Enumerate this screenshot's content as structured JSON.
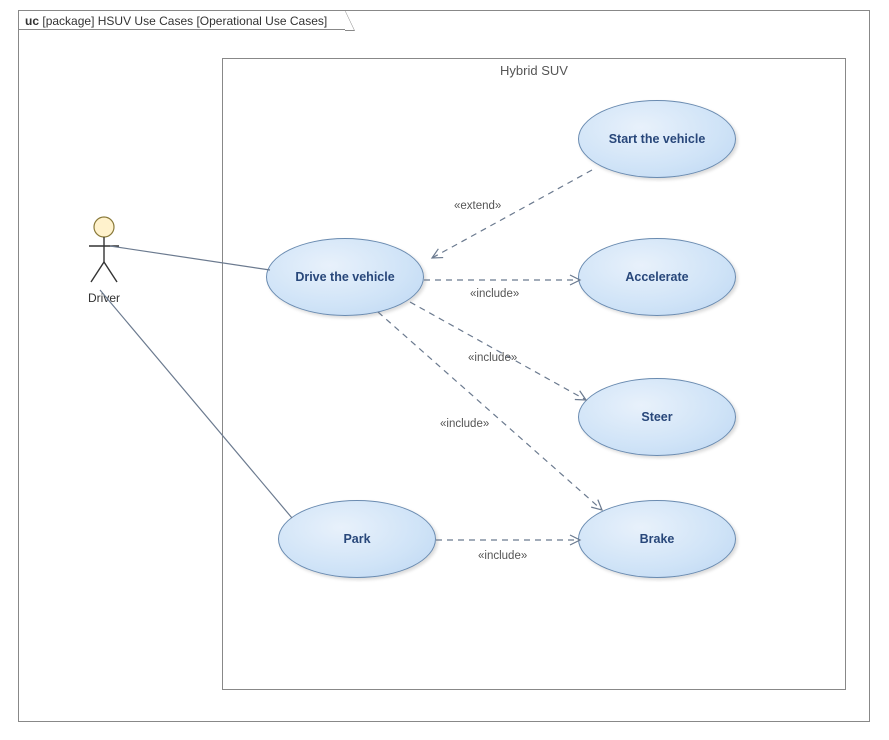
{
  "diagram": {
    "prefix": "uc",
    "kind": "[package]",
    "name": "HSUV Use Cases",
    "qualifier": "[Operational Use Cases]"
  },
  "subject": {
    "title": "Hybrid SUV"
  },
  "actor": {
    "name": "Driver"
  },
  "usecases": {
    "start": "Start the vehicle",
    "drive": "Drive the vehicle",
    "accelerate": "Accelerate",
    "steer": "Steer",
    "park": "Park",
    "brake": "Brake"
  },
  "relations": {
    "extend": "«extend»",
    "include": "«include»"
  },
  "chart_data": {
    "type": "diagram",
    "diagram_type": "uml-use-case",
    "frame": "uc [package] HSUV Use Cases [Operational Use Cases]",
    "subject": "Hybrid SUV",
    "actors": [
      "Driver"
    ],
    "use_cases": [
      "Start the vehicle",
      "Drive the vehicle",
      "Accelerate",
      "Steer",
      "Park",
      "Brake"
    ],
    "associations": [
      {
        "actor": "Driver",
        "usecase": "Drive the vehicle"
      },
      {
        "actor": "Driver",
        "usecase": "Park"
      }
    ],
    "dependencies": [
      {
        "from": "Start the vehicle",
        "to": "Drive the vehicle",
        "stereotype": "extend"
      },
      {
        "from": "Drive the vehicle",
        "to": "Accelerate",
        "stereotype": "include"
      },
      {
        "from": "Drive the vehicle",
        "to": "Steer",
        "stereotype": "include"
      },
      {
        "from": "Drive the vehicle",
        "to": "Brake",
        "stereotype": "include"
      },
      {
        "from": "Park",
        "to": "Brake",
        "stereotype": "include"
      }
    ]
  }
}
